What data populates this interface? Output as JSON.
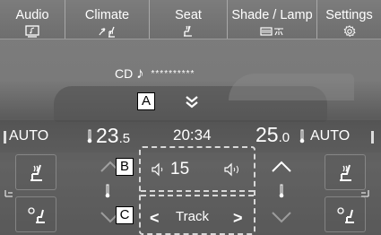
{
  "menu": {
    "tabs": [
      {
        "label": "Audio",
        "icon": "audio-screen-icon"
      },
      {
        "label": "Climate",
        "icon": "climate-fan-seat-icon"
      },
      {
        "label": "Seat",
        "icon": "seat-heater-icon"
      },
      {
        "label": "Shade / Lamp",
        "icon": "shade-lamp-icon"
      },
      {
        "label": "Settings",
        "icon": "gear-icon"
      }
    ]
  },
  "media": {
    "source": "CD",
    "title": "**********"
  },
  "callouts": {
    "a": "A",
    "b": "B",
    "c": "C"
  },
  "climate": {
    "left_mode": "AUTO",
    "left_temp_int": "23",
    "left_temp_dec": ".5",
    "right_temp_int": "25",
    "right_temp_dec": ".0",
    "right_mode": "AUTO"
  },
  "clock": "20:34",
  "audio": {
    "volume": "15",
    "track_label": "Track"
  }
}
